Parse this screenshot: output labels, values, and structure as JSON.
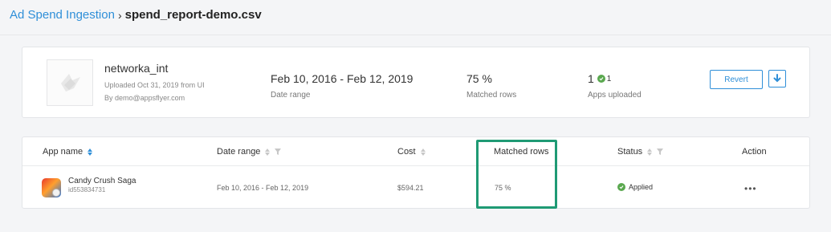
{
  "breadcrumb": {
    "parent": "Ad Spend Ingestion",
    "separator": "›",
    "current": "spend_report-demo.csv"
  },
  "summary": {
    "app_name": "networka_int",
    "uploaded": "Uploaded Oct 31, 2019 from UI",
    "by": "By demo@appsflyer.com",
    "date_range_value": "Feb 10, 2016 - Feb 12, 2019",
    "date_range_label": "Date range",
    "matched_value": "75 %",
    "matched_label": "Matched rows",
    "apps_value": "1",
    "apps_success_count": "1",
    "apps_label": "Apps uploaded",
    "revert_label": "Revert",
    "download_icon": "download-arrow-icon"
  },
  "table": {
    "columns": {
      "app_name": "App name",
      "date_range": "Date range",
      "cost": "Cost",
      "matched_rows": "Matched rows",
      "status": "Status",
      "action": "Action"
    },
    "rows": [
      {
        "app_title": "Candy Crush Saga",
        "app_id": "id553834731",
        "date_range": "Feb 10, 2016 - Feb 12, 2019",
        "cost": "$594.21",
        "matched": "75 %",
        "status": "Applied",
        "action": "•••"
      }
    ]
  },
  "colors": {
    "accent": "#2f8fd8",
    "success": "#5aa84f",
    "highlight": "#1f9a74"
  }
}
